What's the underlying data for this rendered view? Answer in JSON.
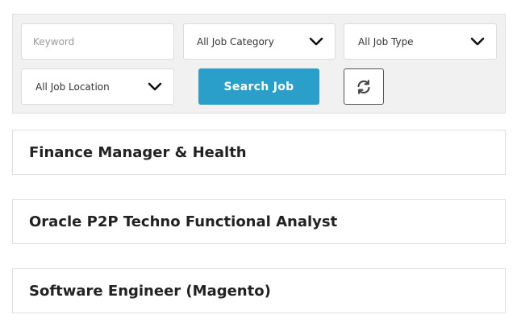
{
  "filters": {
    "keyword_placeholder": "Keyword",
    "keyword_value": "",
    "category_selected": "All Job Category",
    "type_selected": "All Job Type",
    "location_selected": "All Job Location",
    "search_label": "Search Job",
    "reset_icon": "refresh-icon",
    "chevron_icon": "chevron-down-icon"
  },
  "jobs": [
    {
      "title": "Finance Manager & Health"
    },
    {
      "title": "Oracle P2P Techno Functional Analyst"
    },
    {
      "title": "Software Engineer (Magento)"
    }
  ],
  "colors": {
    "accent": "#2a9fc9",
    "panel_bg": "#f1f1f1",
    "border": "#dcdcdc"
  }
}
